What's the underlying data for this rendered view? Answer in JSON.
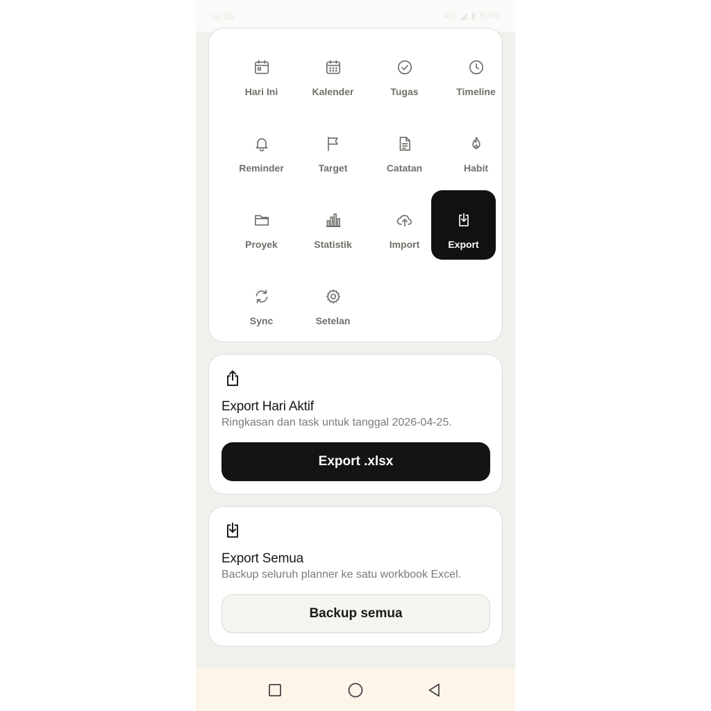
{
  "status_bar": {
    "time": "10:36",
    "indicators": "4G ◢ ▮ 83%"
  },
  "menu": {
    "items": [
      {
        "label": "Hari Ini",
        "icon": "calendar-day-icon"
      },
      {
        "label": "Kalender",
        "icon": "calendar-grid-icon"
      },
      {
        "label": "Tugas",
        "icon": "check-circle-icon"
      },
      {
        "label": "Timeline",
        "icon": "clock-icon"
      },
      {
        "label": "Reminder",
        "icon": "bell-icon"
      },
      {
        "label": "Target",
        "icon": "flag-icon"
      },
      {
        "label": "Catatan",
        "icon": "note-icon"
      },
      {
        "label": "Habit",
        "icon": "flame-icon"
      },
      {
        "label": "Proyek",
        "icon": "folder-icon"
      },
      {
        "label": "Statistik",
        "icon": "bar-chart-icon"
      },
      {
        "label": "Import",
        "icon": "cloud-upload-icon"
      },
      {
        "label": "Export",
        "icon": "download-tray-icon",
        "active": true
      },
      {
        "label": "Sync",
        "icon": "sync-icon"
      },
      {
        "label": "Setelan",
        "icon": "gear-icon"
      }
    ]
  },
  "export_active": {
    "icon": "share-upload-icon",
    "title": "Export Hari Aktif",
    "subtitle": "Ringkasan dan task untuk tanggal 2026-04-25.",
    "button_label": "Export .xlsx"
  },
  "export_all": {
    "icon": "download-tray-icon",
    "title": "Export Semua",
    "subtitle": "Backup seluruh planner ke satu workbook Excel.",
    "button_label": "Backup semua"
  },
  "nav_bar": {
    "items": [
      "recent-apps-icon",
      "home-icon",
      "back-icon"
    ]
  },
  "colors": {
    "accent": "#111111",
    "background": "#f1f0ec",
    "card": "#ffffff",
    "nav_bg": "#fdf4ea"
  }
}
